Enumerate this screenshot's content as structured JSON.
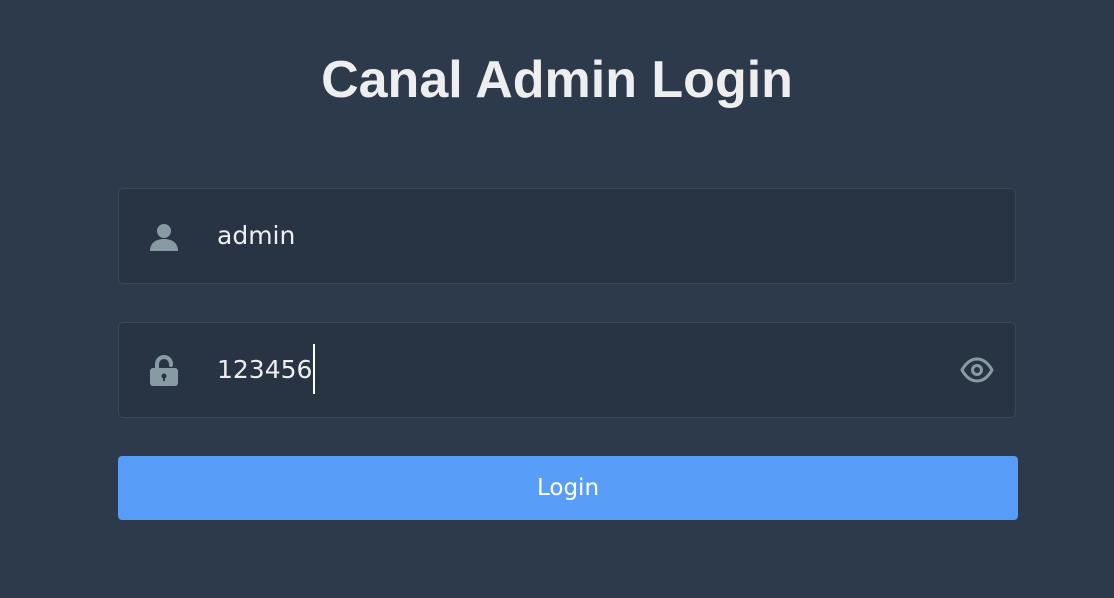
{
  "title": "Canal Admin Login",
  "username": {
    "value": "admin",
    "icon": "user-icon"
  },
  "password": {
    "value": "123456",
    "icon": "lock-icon",
    "toggle_icon": "eye-icon"
  },
  "login_button": {
    "label": "Login"
  },
  "colors": {
    "background": "#2d3a4b",
    "input_background": "#283443",
    "accent": "#589ef8",
    "icon": "#889aa4",
    "text": "#eeeeee"
  }
}
